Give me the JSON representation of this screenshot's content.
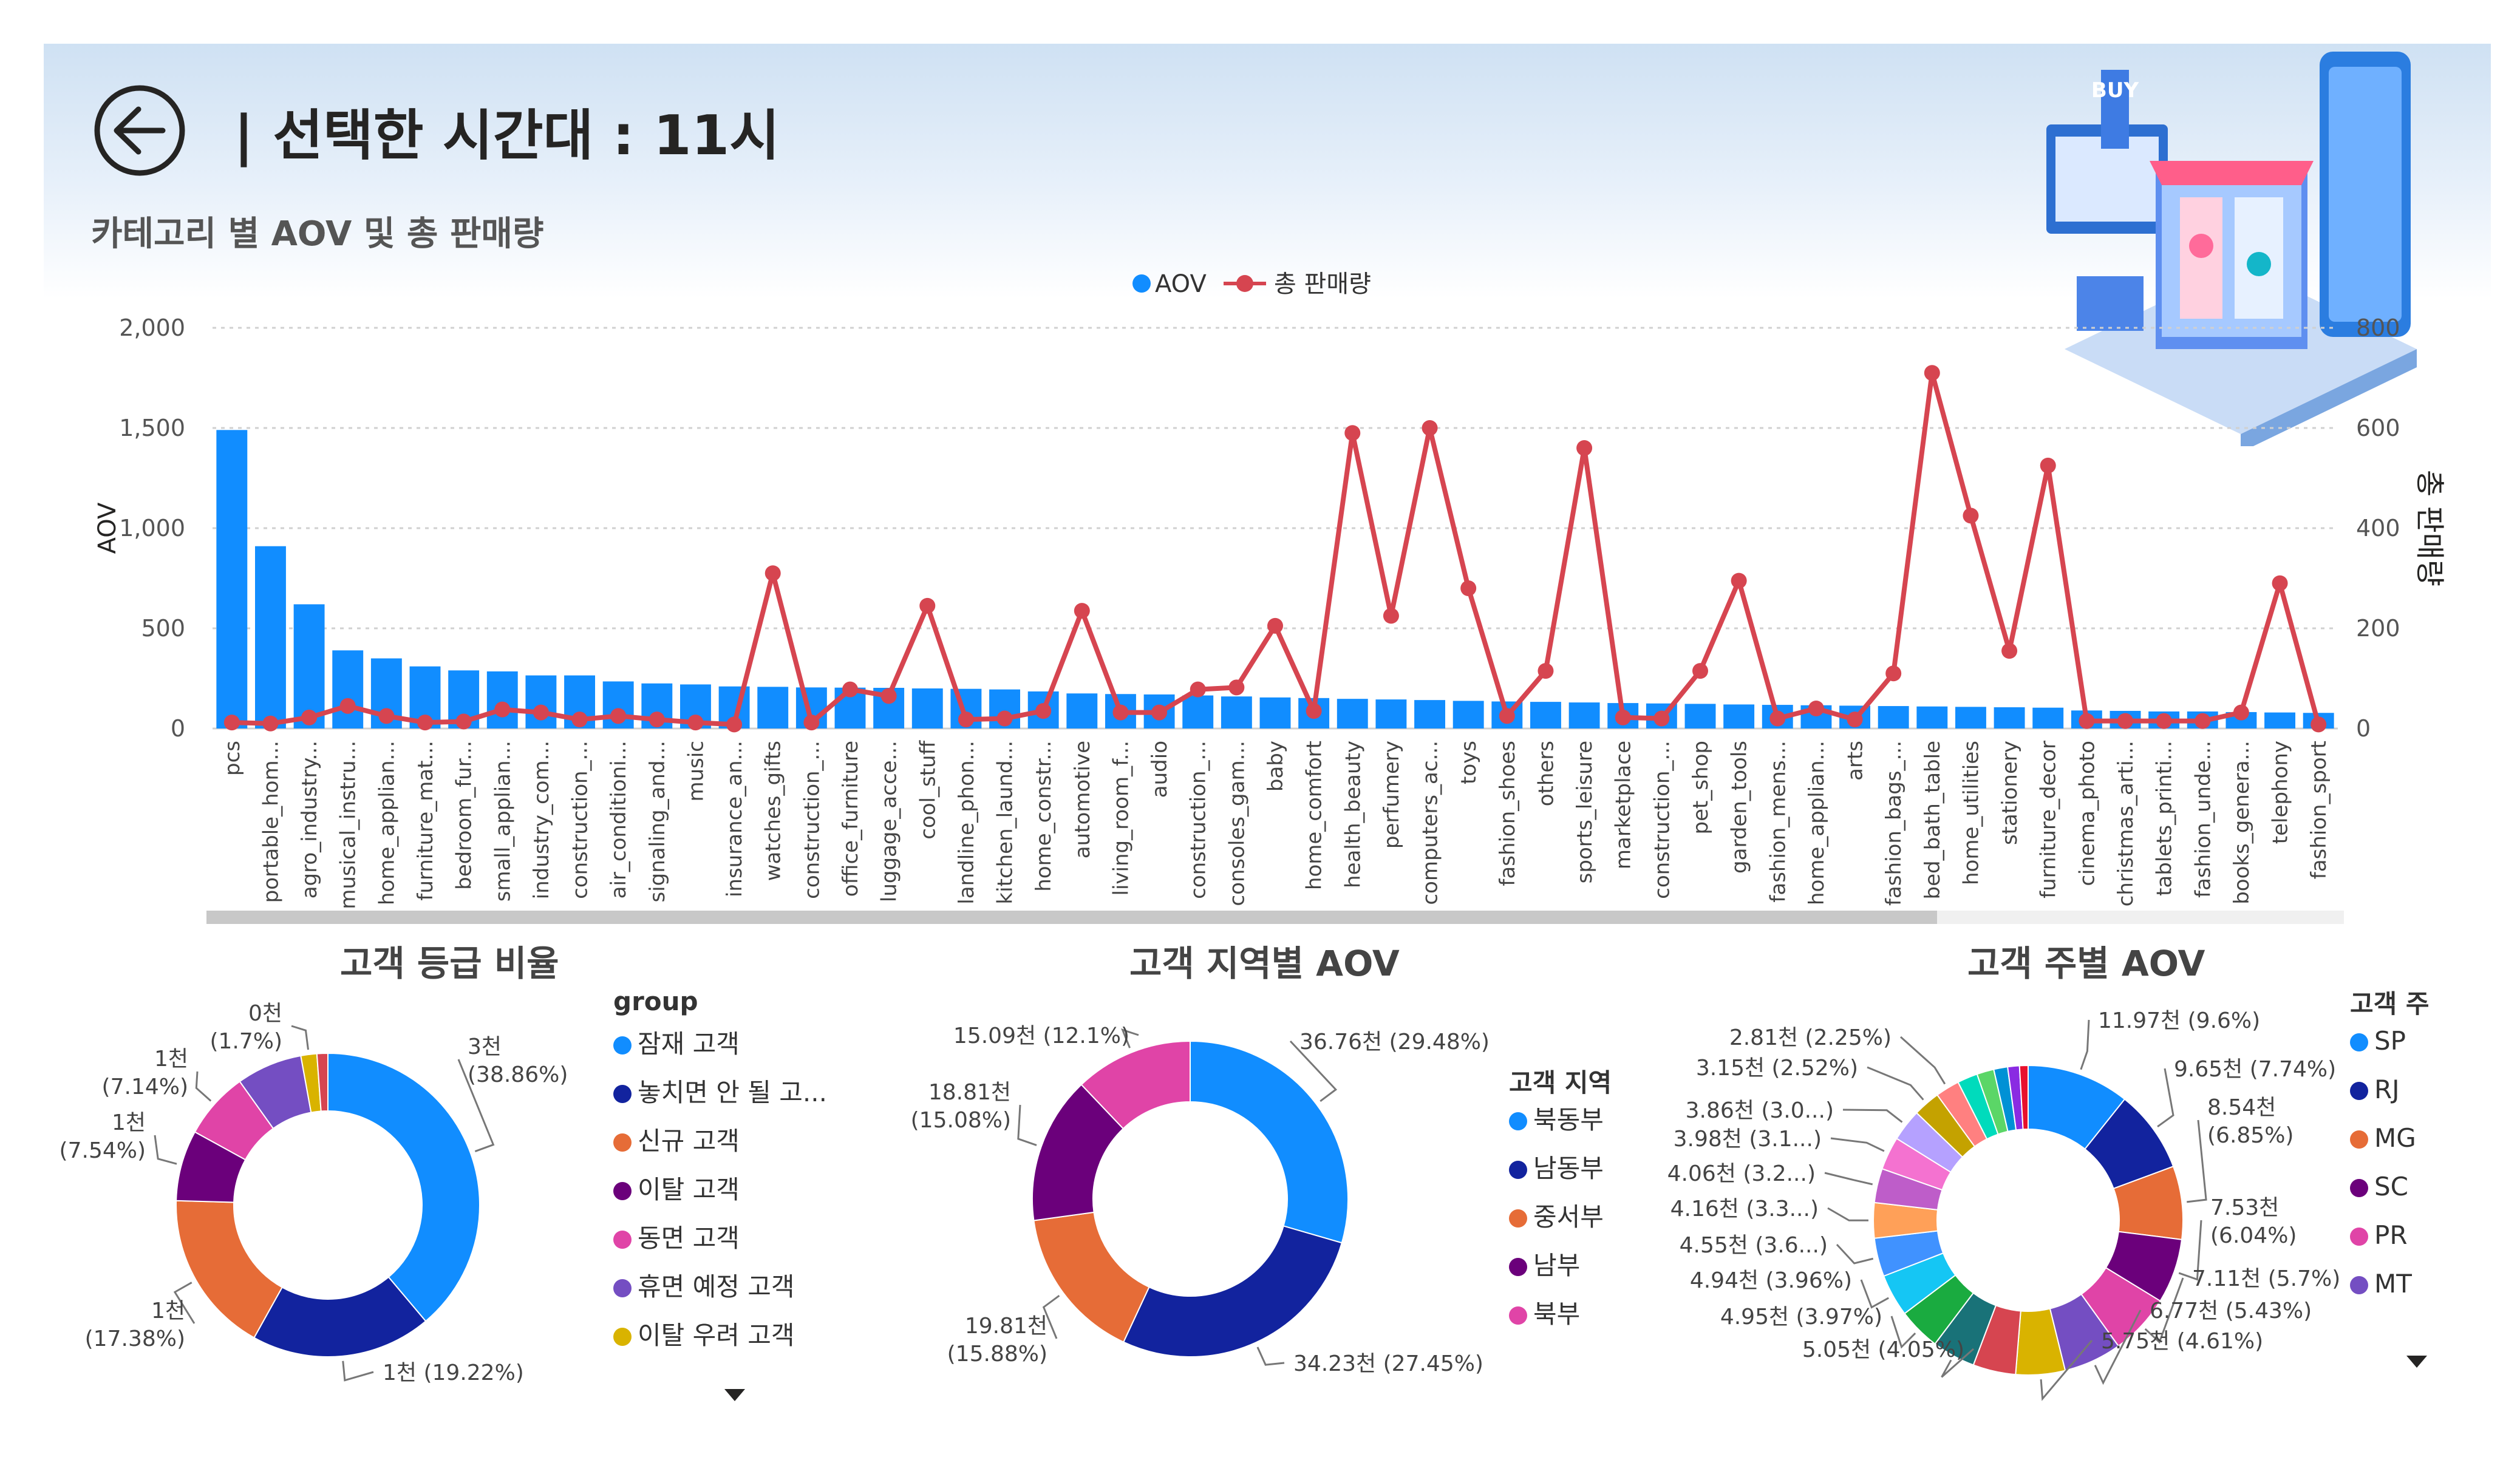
{
  "header": {
    "title": "| 선택한 시간대 : 11시",
    "subtitle": "카테고리 별 AOV 및 총 판매량",
    "back_icon": "back-arrow-icon",
    "hero_icon": "shopping-illustration-icon",
    "hero_text": "BUY"
  },
  "colors": {
    "aov_bar": "#118DFF",
    "sales_line": "#D64550",
    "background_top": "#cfe1f3"
  },
  "chart_data": [
    {
      "type": "bar+line",
      "legend": [
        "AOV",
        "총 판매량"
      ],
      "legend_position": "top-center",
      "ylabel": "AOV",
      "y2label": "총 판매량",
      "ylim": [
        0,
        2000
      ],
      "y2lim": [
        0,
        800
      ],
      "yticks": [
        "0",
        "500",
        "1,000",
        "1,500",
        "2,000"
      ],
      "y2ticks": [
        "0",
        "200",
        "400",
        "600",
        "800"
      ],
      "grid": true,
      "categories": [
        "pcs",
        "portable_hom...",
        "agro_industry...",
        "musical_instru...",
        "home_applian...",
        "furniture_mat...",
        "bedroom_fur...",
        "small_applian...",
        "industry_com...",
        "construction_...",
        "air_conditioni...",
        "signaling_and...",
        "music",
        "insurance_an...",
        "watches_gifts",
        "construction_...",
        "office_furniture",
        "luggage_acce...",
        "cool_stuff",
        "landline_phon...",
        "kitchen_laund...",
        "home_constr...",
        "automotive",
        "living_room_f...",
        "audio",
        "construction_...",
        "consoles_gam...",
        "baby",
        "home_comfort",
        "health_beauty",
        "perfumery",
        "computers_ac...",
        "toys",
        "fashion_shoes",
        "others",
        "sports_leisure",
        "marketplace",
        "construction_...",
        "pet_shop",
        "garden_tools",
        "fashion_mens...",
        "home_applian...",
        "arts",
        "fashion_bags_...",
        "bed_bath_table",
        "home_utilities",
        "stationery",
        "furniture_decor",
        "cinema_photo",
        "christmas_arti...",
        "tablets_printi...",
        "fashion_unde...",
        "books_genera...",
        "telephony",
        "fashion_sport"
      ],
      "series": [
        {
          "name": "AOV",
          "type": "bar",
          "values": [
            1490,
            910,
            620,
            390,
            350,
            310,
            290,
            285,
            265,
            265,
            235,
            225,
            220,
            210,
            208,
            205,
            204,
            203,
            200,
            198,
            195,
            185,
            175,
            172,
            170,
            165,
            160,
            155,
            152,
            148,
            145,
            142,
            138,
            135,
            133,
            130,
            127,
            125,
            123,
            120,
            118,
            116,
            114,
            112,
            110,
            108,
            106,
            104,
            90,
            88,
            85,
            85,
            82,
            80,
            78
          ]
        },
        {
          "name": "총 판매량",
          "type": "line",
          "axis": "right",
          "values": [
            12,
            10,
            22,
            45,
            25,
            12,
            14,
            38,
            32,
            18,
            25,
            18,
            12,
            8,
            310,
            12,
            78,
            65,
            245,
            18,
            20,
            35,
            235,
            32,
            32,
            78,
            82,
            205,
            35,
            590,
            225,
            600,
            280,
            25,
            115,
            560,
            22,
            20,
            115,
            295,
            20,
            40,
            18,
            110,
            710,
            425,
            155,
            525,
            15,
            15,
            15,
            15,
            32,
            290,
            8
          ]
        }
      ]
    },
    {
      "type": "pie",
      "title": "고객 등급 비율",
      "legend_title": "group",
      "legend": [
        "잠재 고객",
        "놓치면 안 될 고...",
        "신규 고객",
        "이탈 고객",
        "동면 고객",
        "휴면 예정 고객",
        "이탈 우려 고객"
      ],
      "values": [
        38.86,
        19.22,
        17.38,
        7.54,
        7.14,
        7.0,
        1.7,
        1.16
      ],
      "colors": [
        "#118DFF",
        "#12239E",
        "#E66C37",
        "#6B007B",
        "#E044A7",
        "#744EC2",
        "#D9B300",
        "#D64550"
      ],
      "labels": [
        "3천\n(38.86%)",
        "1천 (19.22%)",
        "1천\n(17.38%)",
        "1천\n(7.54%)",
        "1천\n(7.14%)",
        "",
        "0천\n(1.7%)",
        ""
      ]
    },
    {
      "type": "pie",
      "title": "고객 지역별 AOV",
      "legend_title": "고객 지역",
      "legend": [
        "북동부",
        "남동부",
        "중서부",
        "남부",
        "북부"
      ],
      "values": [
        29.48,
        27.45,
        15.88,
        15.08,
        12.1
      ],
      "colors": [
        "#118DFF",
        "#12239E",
        "#E66C37",
        "#6B007B",
        "#E044A7"
      ],
      "labels": [
        "36.76천 (29.48%)",
        "34.23천 (27.45%)",
        "19.81천\n(15.88%)",
        "18.81천\n(15.08%)",
        "15.09천 (12.1%)"
      ]
    },
    {
      "type": "pie",
      "title": "고객 주별 AOV",
      "legend_title": "고객 주",
      "legend": [
        "SP",
        "RJ",
        "MG",
        "SC",
        "PR",
        "MT"
      ],
      "values": [
        9.6,
        7.74,
        6.85,
        6.04,
        5.7,
        5.43,
        4.61,
        4.0,
        4.05,
        3.97,
        3.96,
        3.6,
        3.3,
        3.2,
        3.1,
        3.0,
        2.52,
        2.25,
        1.9,
        1.6,
        1.3,
        1.1,
        0.8
      ],
      "colors": [
        "#118DFF",
        "#12239E",
        "#E66C37",
        "#6B007B",
        "#E044A7",
        "#744EC2",
        "#D9B300",
        "#D64550",
        "#197278",
        "#1AAB40",
        "#15C6F4",
        "#4092FF",
        "#FFA058",
        "#BE5DC9",
        "#F472D0",
        "#B5A1FF",
        "#C4A200",
        "#FF8080",
        "#00DBBC",
        "#5BD667",
        "#0091D5",
        "#8A2BE2",
        "#E8112D"
      ],
      "labels": [
        "11.97천 (9.6%)",
        "9.65천 (7.74%)",
        "8.54천\n(6.85%)",
        "7.53천\n(6.04%)",
        "7.11천 (5.7%)",
        "6.77천 (5.43%)",
        "5.75천 (4.61%)",
        "",
        "5.05천 (4.05%)",
        "4.95천 (3.97%)",
        "4.94천 (3.96%)",
        "4.55천 (3.6...)",
        "4.16천 (3.3...)",
        "4.06천 (3.2...)",
        "3.98천 (3.1...)",
        "3.86천 (3.0...)",
        "3.15천 (2.52%)",
        "2.81천 (2.25%)",
        "",
        "",
        "",
        "",
        ""
      ]
    }
  ]
}
